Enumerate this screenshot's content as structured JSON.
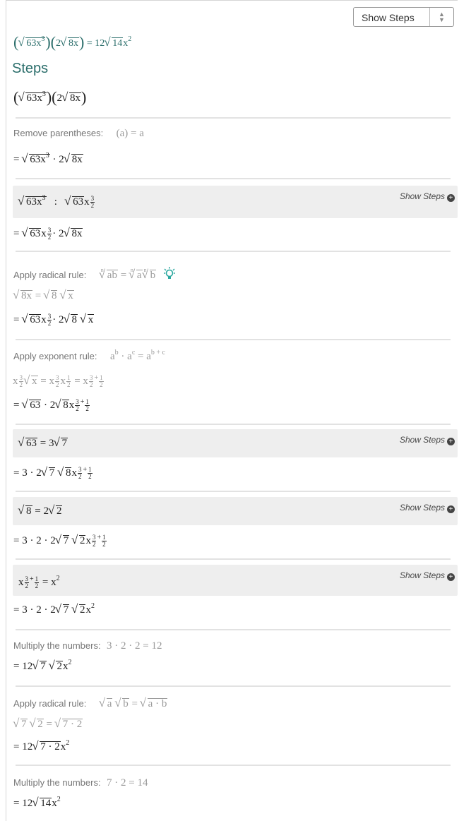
{
  "dropdown": {
    "selected": "Show Steps"
  },
  "header": {
    "rhs": "= 12",
    "rhs_rad": "14",
    "rhs_var": "x"
  },
  "steps_title": "Steps",
  "show_steps_link": "Show Steps",
  "labels": {
    "remove_paren": "Remove parentheses:",
    "apply_radical": "Apply radical rule:",
    "apply_exponent": "Apply exponent rule:",
    "multiply": "Multiply the numbers:"
  },
  "lines": {
    "paren_rule": "(a) = a",
    "multiply_1": "3 · 2 · 2 = 12",
    "multiply_2": "7 · 2 = 14"
  }
}
